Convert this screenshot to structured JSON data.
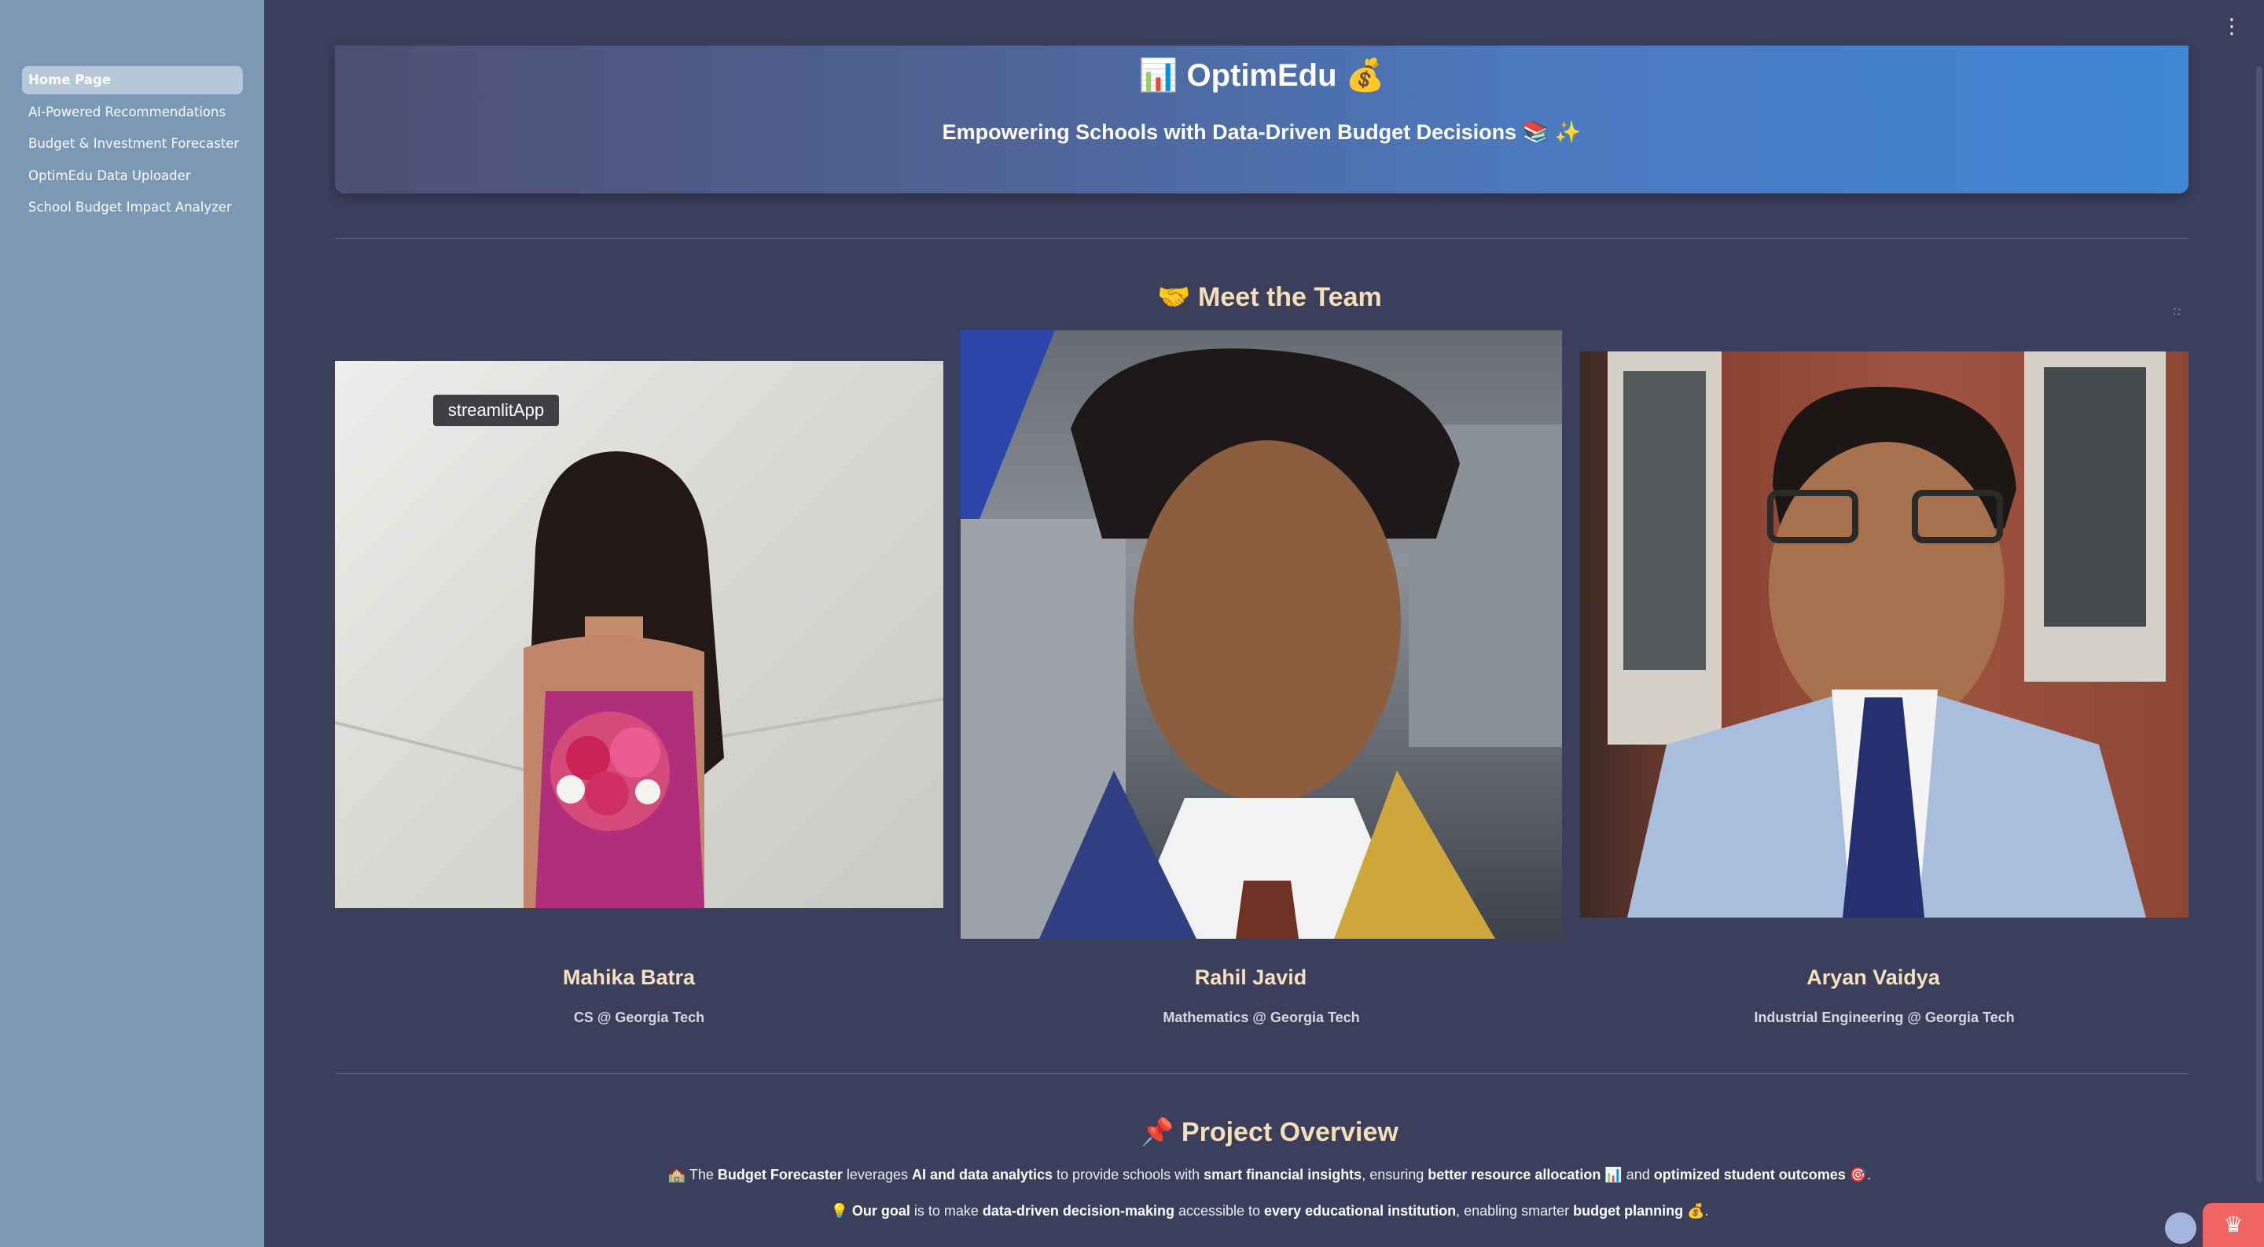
{
  "sidebar": {
    "items": [
      {
        "label": "Home Page",
        "active": true
      },
      {
        "label": "AI-Powered Recommendations",
        "active": false
      },
      {
        "label": "Budget & Investment Forecaster",
        "active": false
      },
      {
        "label": "OptimEdu Data Uploader",
        "active": false
      },
      {
        "label": "School Budget Impact Analyzer",
        "active": false
      }
    ]
  },
  "header": {
    "title": "📊 OptimEdu 💰",
    "subtitle": "Empowering Schools with Data-Driven Budget Decisions 📚 ✨"
  },
  "team": {
    "title": "🤝 Meet the Team",
    "tooltip": "streamlitApp",
    "members": [
      {
        "name": "Mahika Batra",
        "role": "CS @ Georgia Tech"
      },
      {
        "name": "Rahil Javid",
        "role": "Mathematics @ Georgia Tech"
      },
      {
        "name": "Aryan Vaidya",
        "role": "Industrial Engineering @ Georgia Tech"
      }
    ]
  },
  "overview": {
    "title": "📌 Project Overview",
    "line1": [
      "🏫 The ",
      "Budget Forecaster",
      " leverages ",
      "AI and data analytics",
      " to provide schools with ",
      "smart financial insights",
      ", ensuring ",
      "better resource allocation",
      " 📊 and ",
      "optimized student outcomes",
      " 🎯."
    ],
    "line2": [
      "💡 ",
      "Our goal",
      " is to make ",
      "data-driven decision-making",
      " accessible to ",
      "every educational institution",
      ", enabling smarter ",
      "budget planning",
      " 💰."
    ]
  },
  "colors": {
    "background": "#3c3f5c",
    "sidebar": "#7b98b5",
    "accent": "#f4dfb6",
    "badge": "#f06464"
  },
  "icons": {
    "menu": "vertical-dots-icon",
    "fullscreen": "fullscreen-icon",
    "crown": "crown-icon",
    "logo": "streamlit-logo-icon"
  }
}
